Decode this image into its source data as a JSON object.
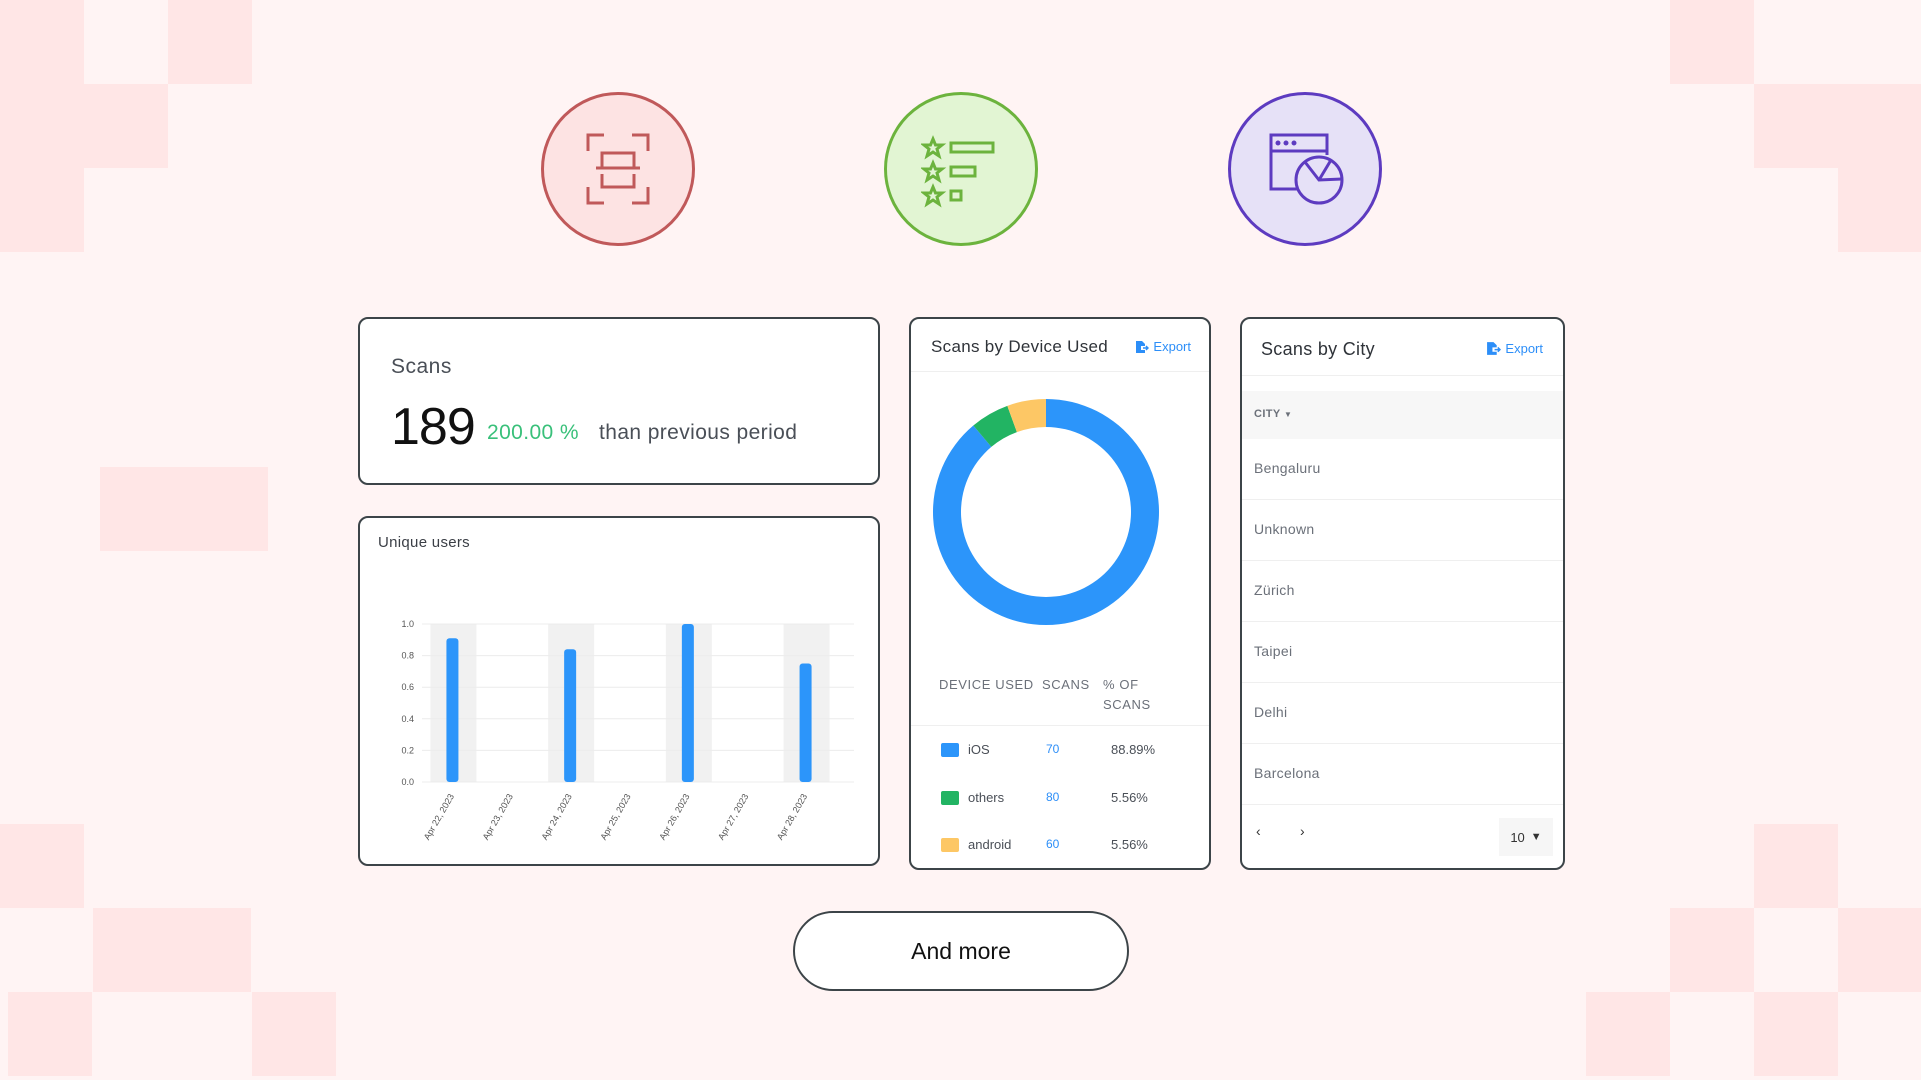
{
  "colors": {
    "background": "#fff4f4",
    "checker": "#ffe6e6",
    "accent_blue": "#2c8ef8",
    "positive_green": "#39c07a",
    "icon_red": "#c0595a",
    "icon_green": "#6cb33d",
    "icon_purple": "#5d3bc0"
  },
  "feature_icons": [
    {
      "name": "scan-icon"
    },
    {
      "name": "rating-list-icon"
    },
    {
      "name": "dashboard-chart-icon"
    }
  ],
  "scans_card": {
    "title": "Scans",
    "value": "189",
    "change": "200.00 %",
    "change_suffix": "than previous period"
  },
  "unique_users_card": {
    "title": "Unique users"
  },
  "device_card": {
    "title": "Scans by Device Used",
    "export_label": "Export",
    "columns": [
      "DEVICE USED",
      "SCANS",
      "% OF",
      "SCANS"
    ],
    "rows": [
      {
        "device": "iOS",
        "scans": "70",
        "percent": "88.89%",
        "color": "#2c95fa"
      },
      {
        "device": "others",
        "scans": "80",
        "percent": "5.56%",
        "color": "#22b463"
      },
      {
        "device": "android",
        "scans": "60",
        "percent": "5.56%",
        "color": "#fdc765"
      }
    ]
  },
  "city_card": {
    "title": "Scans by City",
    "export_label": "Export",
    "column": "CITY",
    "rows": [
      "Bengaluru",
      "Unknown",
      "Zürich",
      "Taipei",
      "Delhi",
      "Barcelona"
    ],
    "page_size": "10",
    "prev_label": "‹",
    "next_label": "›"
  },
  "more_button": {
    "label": "And more"
  },
  "chart_data": [
    {
      "type": "bar",
      "title": "Unique users",
      "categories": [
        "Apr 22, 2023",
        "Apr 23, 2023",
        "Apr 24, 2023",
        "Apr 25, 2023",
        "Apr 26, 2023",
        "Apr 27, 2023",
        "Apr 28, 2023"
      ],
      "values": [
        0.91,
        0,
        0.84,
        0,
        1.0,
        0,
        0.75
      ],
      "xlabel": "",
      "ylabel": "",
      "ylim": [
        0,
        1.0
      ],
      "yticks": [
        "0.0",
        "0.2",
        "0.4",
        "0.6",
        "0.8",
        "1.0"
      ],
      "grid": true,
      "color": "#2c95fa"
    },
    {
      "type": "pie",
      "title": "Scans by Device Used",
      "donut": true,
      "labels": [
        "iOS",
        "others",
        "android"
      ],
      "values": [
        88.89,
        5.56,
        5.56
      ],
      "colors": [
        "#2c95fa",
        "#22b463",
        "#fdc765"
      ]
    }
  ]
}
